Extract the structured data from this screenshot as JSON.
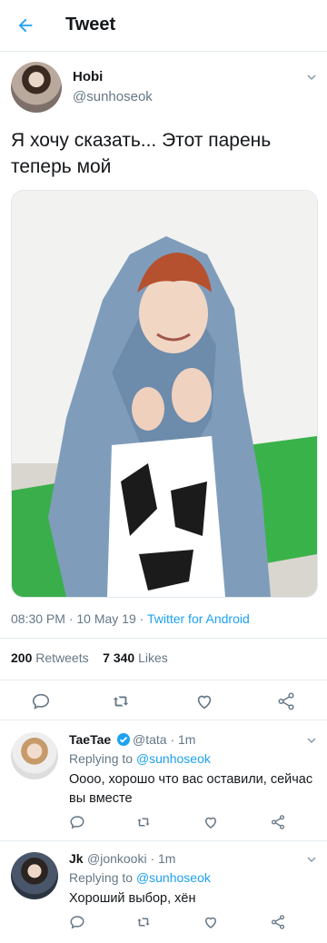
{
  "header": {
    "back_icon": "arrow-left-icon",
    "title": "Tweet",
    "accent": "#1da1f2"
  },
  "tweet": {
    "name": "Hobi",
    "handle": "@sunhoseok",
    "text": "Я хочу сказать... Этот парень теперь мой",
    "time": "08:30 PM · 10 May 19 ·",
    "source": "Twitter for Android",
    "retweets_count": "200",
    "retweets_label": "Retweets",
    "likes_count": "7 340",
    "likes_label": "Likes"
  },
  "actions": [
    "reply-icon",
    "retweet-icon",
    "like-icon",
    "share-icon"
  ],
  "replies": [
    {
      "name": "TaeTae",
      "handle": "@tata · 1m",
      "replying_prefix": "Replying to",
      "replying_to": "@sunhoseok",
      "text": "Оооо, хорошо что вас оставили, сейчас вы вместе",
      "verified": true
    },
    {
      "name": "Jk",
      "handle": "@jonkooki · 1m",
      "replying_prefix": "Replying to",
      "replying_to": "@sunhoseok",
      "text": "Хороший выбор, хён",
      "verified": false
    }
  ]
}
